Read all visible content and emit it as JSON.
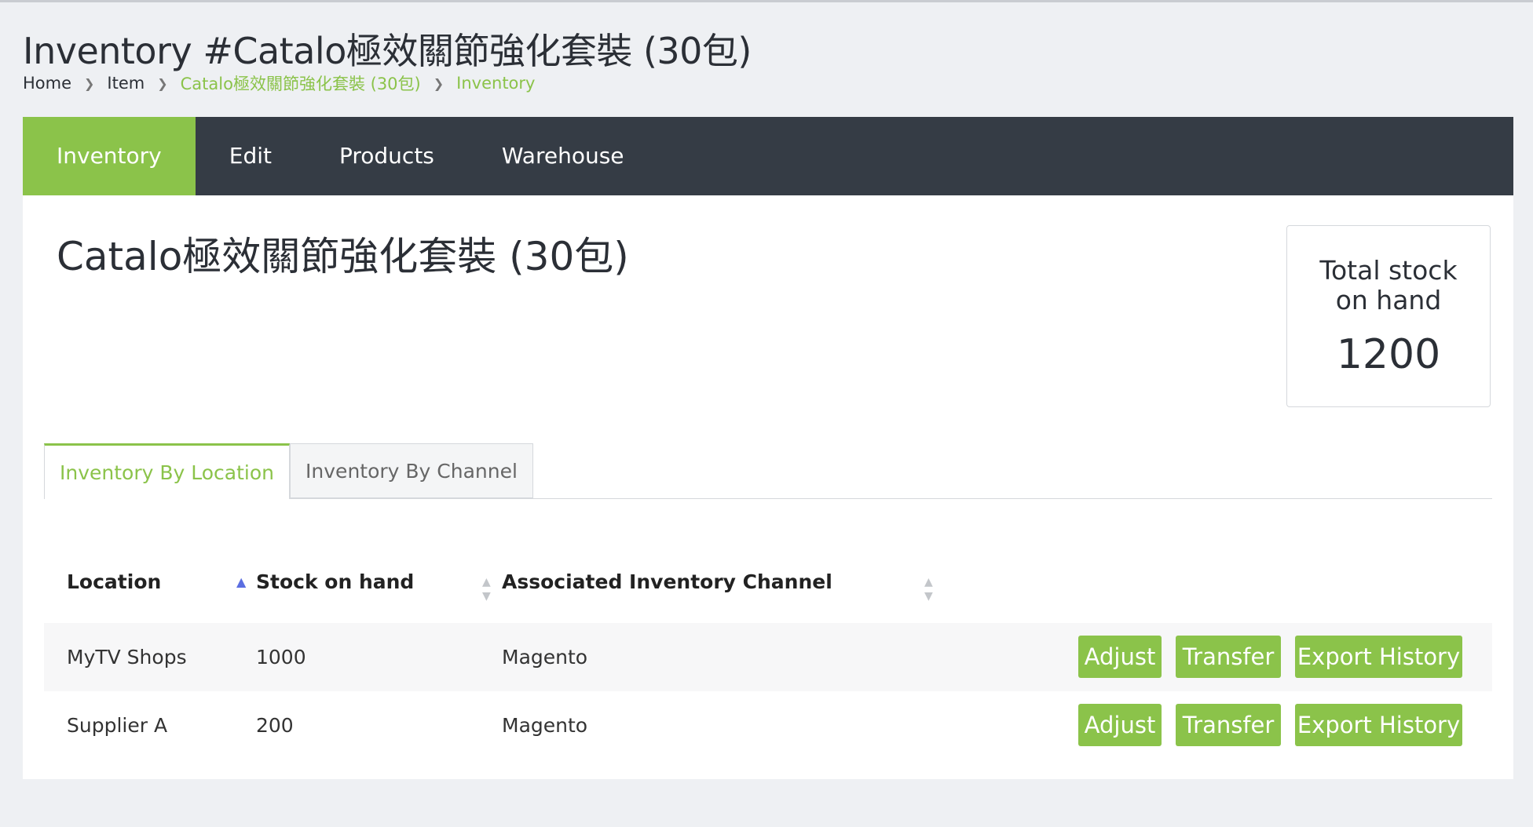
{
  "page": {
    "title": "Inventory #Catalo極效關節強化套裝 (30包)"
  },
  "breadcrumb": [
    {
      "label": "Home"
    },
    {
      "label": "Item"
    },
    {
      "label": "Catalo極效關節強化套裝 (30包)"
    },
    {
      "label": "Inventory"
    }
  ],
  "nav": {
    "tabs": [
      {
        "label": "Inventory",
        "active": true
      },
      {
        "label": "Edit"
      },
      {
        "label": "Products"
      },
      {
        "label": "Warehouse"
      }
    ]
  },
  "item": {
    "name": "Catalo極效關節強化套裝 (30包)"
  },
  "stock_card": {
    "label_line1": "Total stock",
    "label_line2": "on hand",
    "value": "1200"
  },
  "subtabs": [
    {
      "label": "Inventory By Location",
      "active": true
    },
    {
      "label": "Inventory By Channel"
    }
  ],
  "table": {
    "columns": [
      {
        "label": "Location",
        "sort": "ascending"
      },
      {
        "label": "Stock on hand",
        "sort": "none"
      },
      {
        "label": "Associated Inventory Channel",
        "sort": "none"
      }
    ],
    "rows": [
      {
        "location": "MyTV Shops",
        "stock": "1000",
        "channel": "Magento"
      },
      {
        "location": "Supplier A",
        "stock": "200",
        "channel": "Magento"
      }
    ],
    "actions": {
      "adjust": "Adjust",
      "transfer": "Transfer",
      "export": "Export History"
    }
  },
  "colors": {
    "accent": "#8bc34a",
    "nav_bg": "#353c45",
    "page_bg": "#eef0f3",
    "sort_active": "#5b6ee1"
  },
  "icons": {
    "breadcrumb_separator": "chevron-right-icon",
    "sort_ascending": "sort-ascending-icon",
    "sort_neutral": "sort-both-icon"
  }
}
